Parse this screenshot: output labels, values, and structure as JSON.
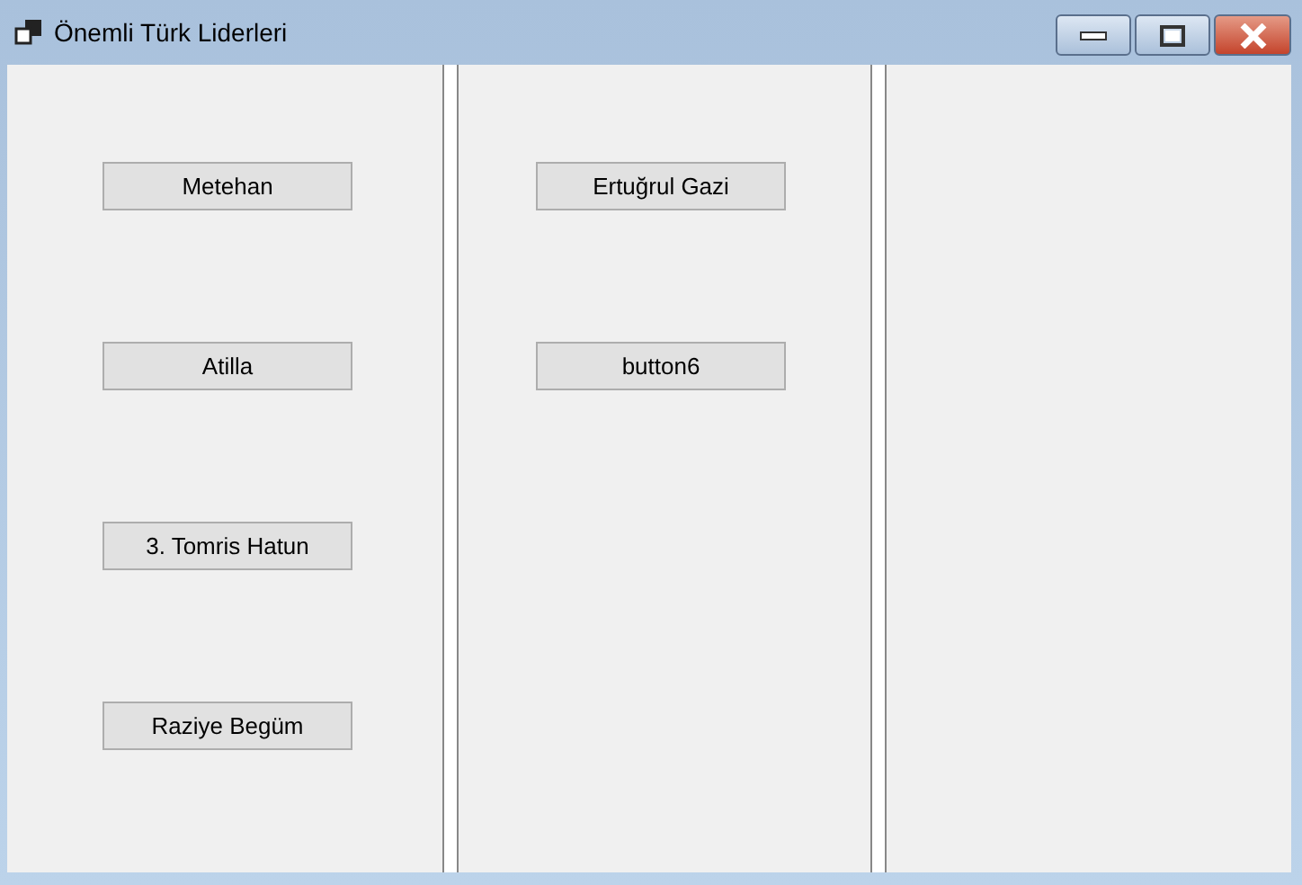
{
  "window": {
    "title": "Önemli Türk Liderleri"
  },
  "panels": [
    {
      "buttons": [
        "Metehan",
        "Atilla",
        "3. Tomris Hatun",
        "Raziye Begüm"
      ]
    },
    {
      "buttons": [
        "Ertuğrul Gazi",
        "button6"
      ]
    }
  ]
}
